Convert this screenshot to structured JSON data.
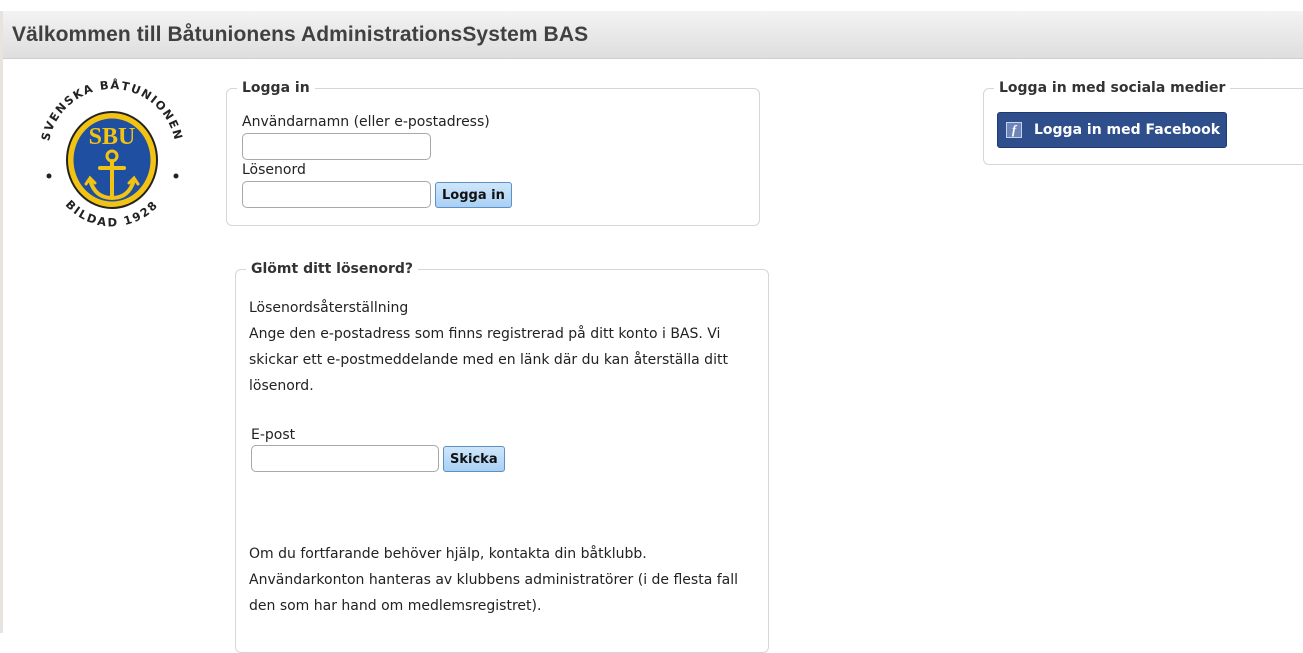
{
  "header": {
    "title": "Välkommen till Båtunionens AdministrationsSystem BAS"
  },
  "logo": {
    "top_text": "SVENSKA BÅTUNIONEN",
    "bottom_text": "BILDAD 1928",
    "center_text": "SBU"
  },
  "login": {
    "legend": "Logga in",
    "username_label": "Användarnamn (eller e-postadress)",
    "username_value": "",
    "password_label": "Lösenord",
    "password_value": "",
    "submit_label": "Logga in"
  },
  "social": {
    "legend": "Logga in med sociala medier",
    "facebook_label": "Logga in med Facebook",
    "facebook_icon": "facebook-icon"
  },
  "forgot": {
    "legend": "Glömt ditt lösenord?",
    "heading": "Lösenordsåterställning",
    "description": "Ange den e-postadress som finns registrerad på ditt konto i BAS. Vi skickar ett e-postmeddelande med en länk där du kan återställa ditt lösenord.",
    "email_label": "E-post",
    "email_value": "",
    "submit_label": "Skicka",
    "help_text": "Om du fortfarande behöver hjälp, kontakta din båtklubb. Användarkonton hanteras av klubbens administratörer (i de flesta fall den som har hand om medlemsregistret)."
  },
  "colors": {
    "facebook_blue": "#2f4e8c",
    "button_blue": "#a9d0f5",
    "logo_blue": "#1f4fa0",
    "logo_gold": "#f2c312"
  }
}
